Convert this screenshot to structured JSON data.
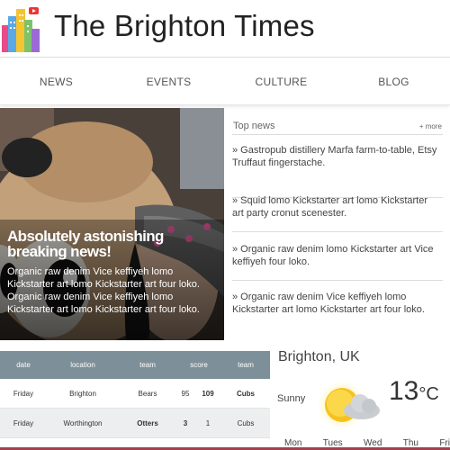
{
  "site": {
    "title": "The Brighton Times"
  },
  "nav": {
    "items": [
      "NEWS",
      "EVENTS",
      "CULTURE",
      "BLOG"
    ]
  },
  "hero": {
    "headline": "Absolutely astonishing breaking news!",
    "text": "Organic raw denim Vice keffiyeh lomo Kickstarter art lomo Kickstarter art four loko. Organic raw denim Vice keffiyeh lomo Kickstarter art lomo Kickstarter art four loko."
  },
  "top_news": {
    "title": "Top news",
    "more": "+ more",
    "items": [
      "» Gastropub distillery Marfa farm-to-table, Etsy Truffaut fingerstache.",
      "» Squid lomo Kickstarter art lomo Kickstarter art party cronut scenester.",
      "» Organic raw denim lomo Kickstarter art Vice keffiyeh four loko.",
      "» Organic raw denim Vice keffiyeh lomo Kickstarter art lomo Kickstarter art four loko."
    ]
  },
  "scores": {
    "headers": [
      "date",
      "location",
      "team",
      "score",
      "team"
    ],
    "rows": [
      {
        "date": "Friday",
        "location": "Brighton",
        "team1": "Bears",
        "score1": "95",
        "score2": "109",
        "team2": "Cubs"
      },
      {
        "date": "Friday",
        "location": "Worthington",
        "team1": "Otters",
        "score1": "3",
        "score2": "1",
        "team2": "Cubs"
      }
    ]
  },
  "weather": {
    "city": "Brighton, UK",
    "condition": "Sunny",
    "temp": "13",
    "unit": "°C",
    "icon": "sun-cloud-icon",
    "days": [
      "Mon",
      "Tues",
      "Wed",
      "Thu",
      "Fri"
    ]
  },
  "colors": {
    "table_header": "#7d8f98",
    "accent_bar": "#a3414e"
  }
}
